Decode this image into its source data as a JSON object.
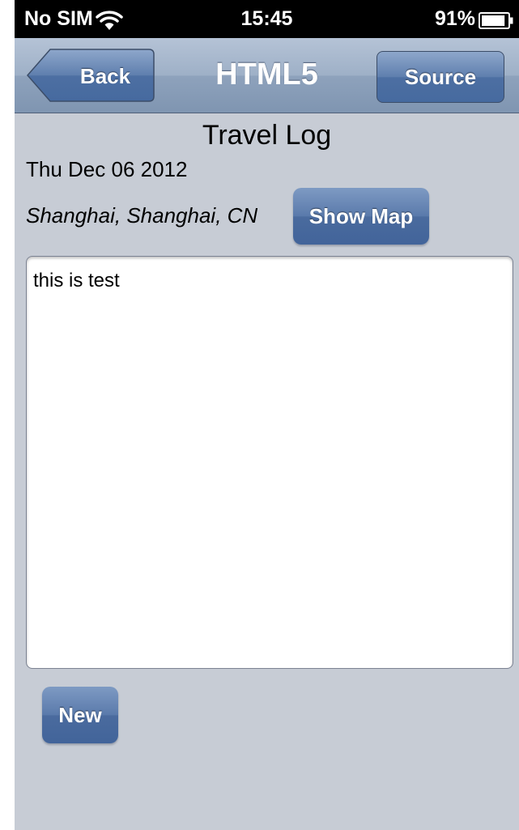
{
  "status_bar": {
    "carrier": "No SIM",
    "time": "15:45",
    "battery_percent": "91%",
    "battery_level": 0.91,
    "icons": [
      "wifi-icon",
      "battery-icon"
    ]
  },
  "nav_bar": {
    "back_label": "Back",
    "title": "HTML5",
    "source_label": "Source"
  },
  "content": {
    "title": "Travel Log",
    "date": "Thu Dec 06 2012",
    "location": "Shanghai, Shanghai, CN",
    "show_map_label": "Show Map",
    "note_text": "this is test",
    "new_label": "New"
  },
  "colors": {
    "nav_bar": "#8ea2bc",
    "button_blue": "#4a6b9e",
    "background": "#c7ccd5"
  }
}
